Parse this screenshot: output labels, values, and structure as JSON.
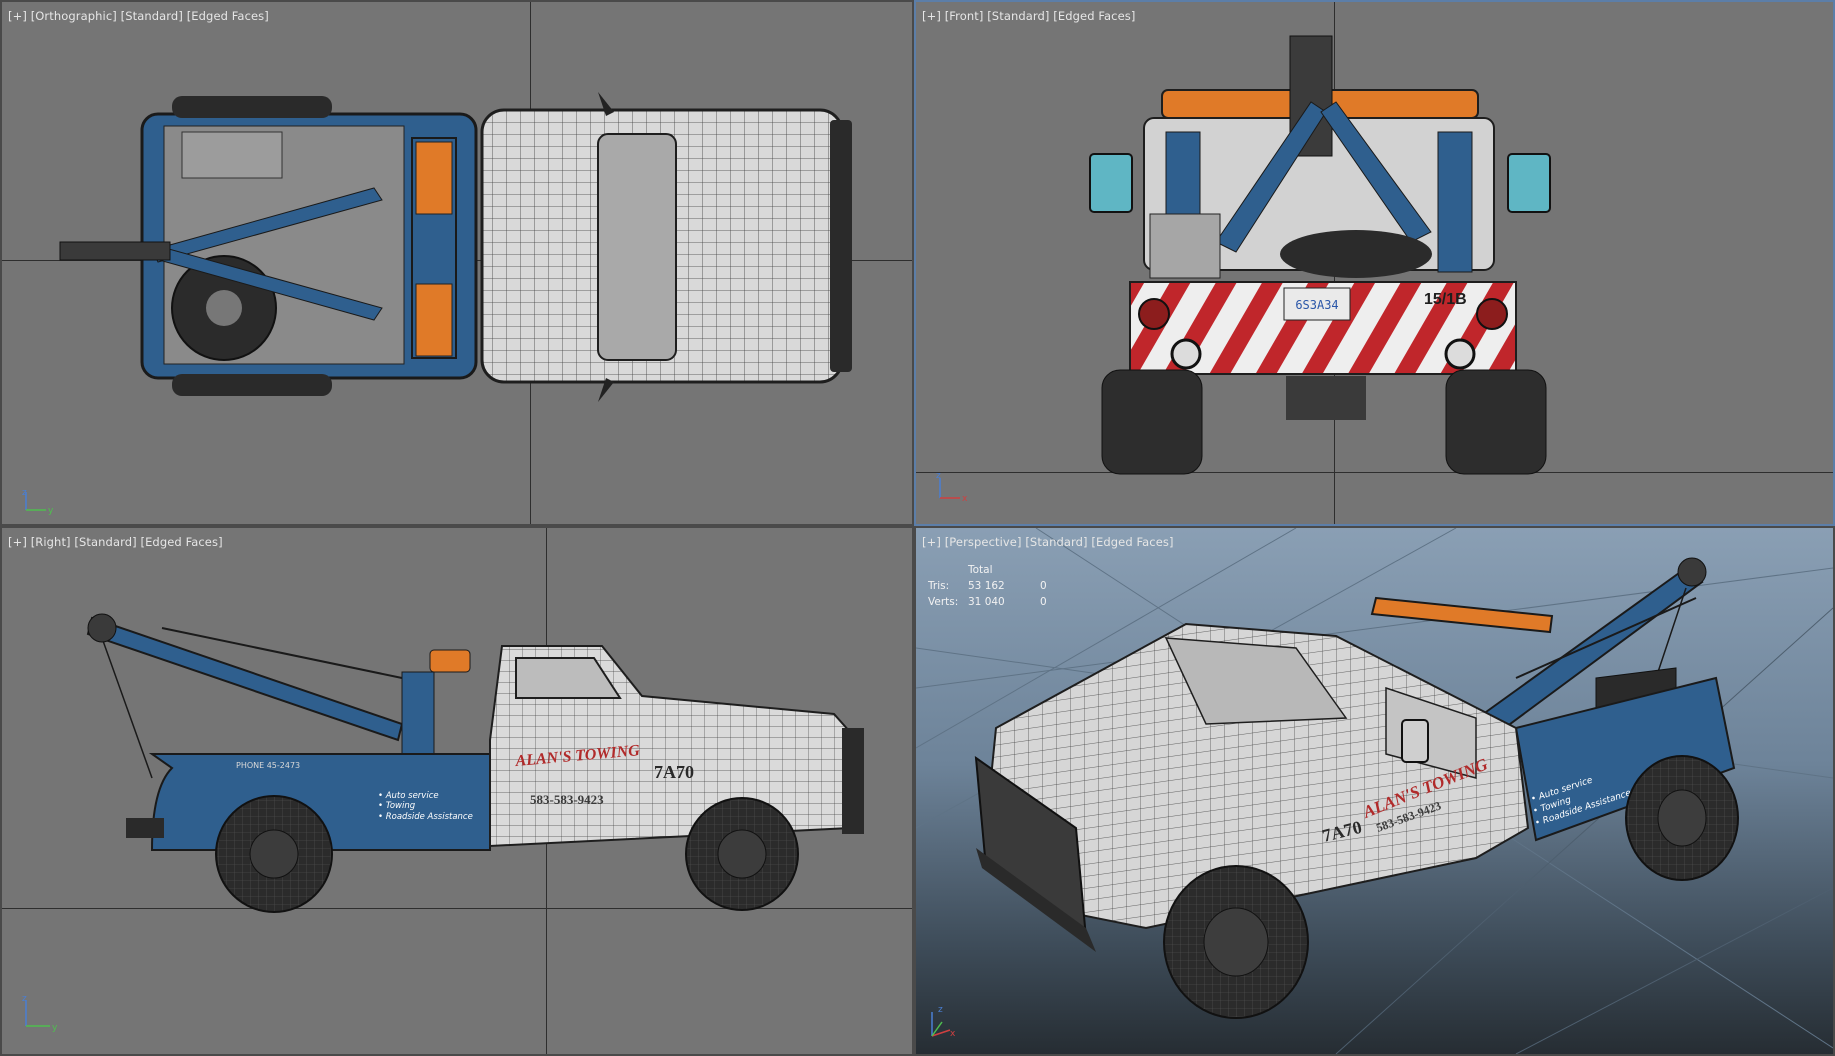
{
  "viewports": {
    "top": {
      "menu": "[+]",
      "view": "[Orthographic]",
      "shading": "[Standard]",
      "faces": "[Edged Faces]",
      "axes": [
        "z",
        "y"
      ]
    },
    "front": {
      "menu": "[+]",
      "view": "[Front]",
      "shading": "[Standard]",
      "faces": "[Edged Faces]",
      "axes": [
        "z",
        "x"
      ],
      "plate_text": "6S3A34",
      "unit_number": "15/1B"
    },
    "right": {
      "menu": "[+]",
      "view": "[Right]",
      "shading": "[Standard]",
      "faces": "[Edged Faces]",
      "axes": [
        "z",
        "y"
      ],
      "door_title": "ALAN'S TOWING",
      "door_phone": "583-583-9423",
      "unit_number": "7A70",
      "bed_phone": "PHONE 45-2473",
      "services": [
        "• Auto service",
        "• Towing",
        "• Roadside Assistance"
      ]
    },
    "perspective": {
      "menu": "[+]",
      "view": "[Perspective]",
      "shading": "[Standard]",
      "faces": "[Edged Faces]",
      "axes": [
        "z",
        "x"
      ],
      "door_title": "ALAN'S TOWING",
      "door_phone": "583-583-9423",
      "unit_number": "7A70",
      "services": [
        "• Auto service",
        "• Towing",
        "• Roadside Assistance"
      ],
      "stats": {
        "header": "Total",
        "rows": [
          {
            "label": "Tris:",
            "total": "53 162",
            "selected": "0"
          },
          {
            "label": "Verts:",
            "total": "31 040",
            "selected": "0"
          }
        ]
      }
    }
  },
  "colors": {
    "viewport_bg": "#757575",
    "active_border": "#5c7ea8",
    "truck_blue": "#2f5f8e",
    "beacon_orange": "#e07a28",
    "stripe_red": "#c0262b",
    "lettering_red": "#b12a2a"
  }
}
